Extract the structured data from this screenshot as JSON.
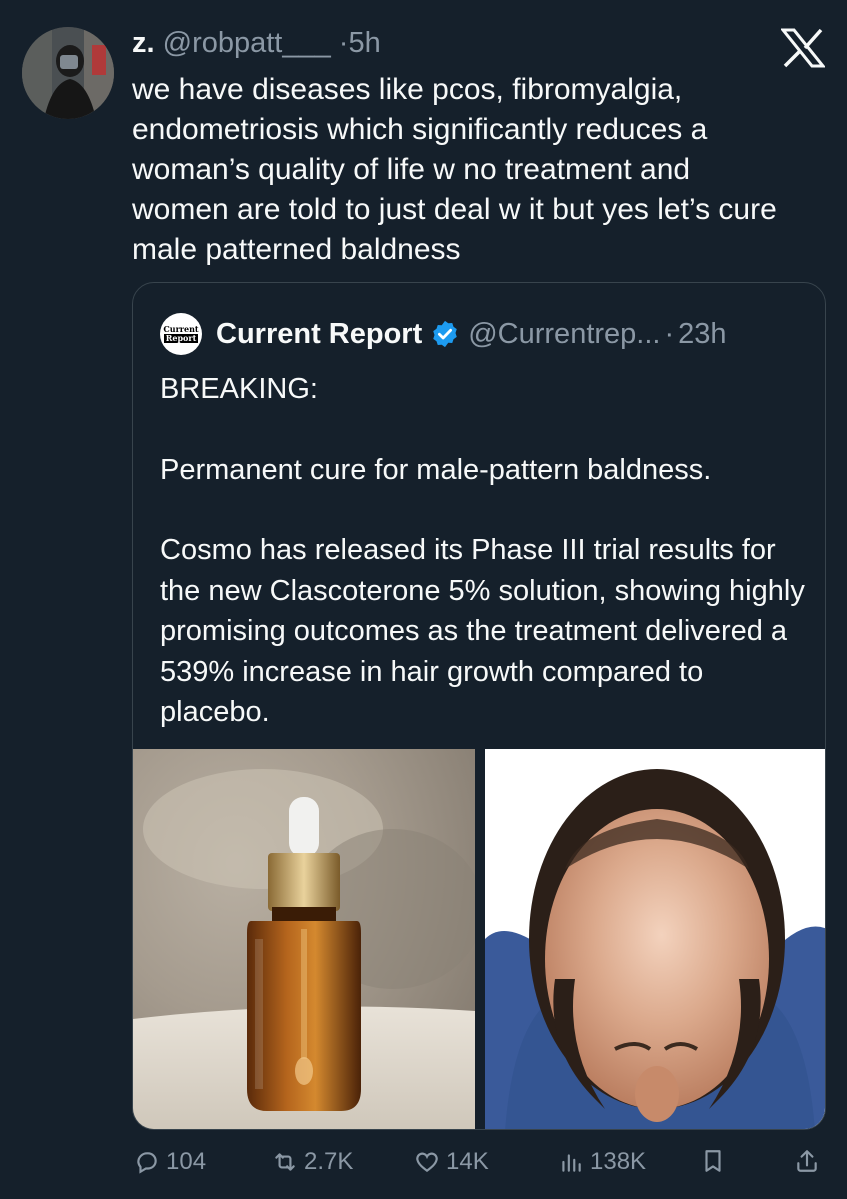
{
  "tweet": {
    "author_name": "z.",
    "author_handle": "@robpatt___",
    "separator": "·",
    "time": "5h",
    "text": "we have diseases like pcos, fibromyalgia, endometriosis which significantly reduces a woman’s quality of life w no treatment and women are told to just deal w it but yes let’s cure male patterned baldness"
  },
  "quoted": {
    "logo_text_top": "Current",
    "logo_text_bottom": "Report",
    "author_name": "Current Report",
    "author_handle": "@Currentrep...",
    "separator": "·",
    "time": "23h",
    "paragraphs": [
      "BREAKING:",
      "Permanent cure for male-pattern baldness.",
      "Cosmo has released its Phase III trial results for the new Clascoterone 5% solution, showing highly promising outcomes as the treatment delivered a 539% increase in hair growth compared to placebo."
    ]
  },
  "actions": {
    "replies": "104",
    "reposts": "2.7K",
    "likes": "14K",
    "views": "138K"
  },
  "colors": {
    "background": "#15202b",
    "text": "#f7f9f9",
    "muted": "#8b98a5",
    "border": "#38444d",
    "verified": "#1d9bf0"
  },
  "icons": [
    "x-logo-icon",
    "verified-badge-icon",
    "reply-icon",
    "repost-icon",
    "like-icon",
    "views-icon",
    "bookmark-icon",
    "share-icon"
  ]
}
